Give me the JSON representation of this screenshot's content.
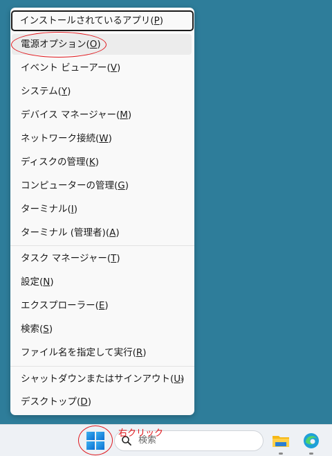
{
  "menu": {
    "items": [
      {
        "label": "インストールされているアプリ(",
        "key": "P",
        "suffix": ")"
      },
      {
        "label": "電源オプション(",
        "key": "O",
        "suffix": ")"
      },
      {
        "label": "イベント ビューアー(",
        "key": "V",
        "suffix": ")"
      },
      {
        "label": "システム(",
        "key": "Y",
        "suffix": ")"
      },
      {
        "label": "デバイス マネージャー(",
        "key": "M",
        "suffix": ")"
      },
      {
        "label": "ネットワーク接続(",
        "key": "W",
        "suffix": ")"
      },
      {
        "label": "ディスクの管理(",
        "key": "K",
        "suffix": ")"
      },
      {
        "label": "コンピューターの管理(",
        "key": "G",
        "suffix": ")"
      },
      {
        "label": "ターミナル(",
        "key": "I",
        "suffix": ")"
      },
      {
        "label": "ターミナル (管理者)(",
        "key": "A",
        "suffix": ")"
      },
      {
        "label": "タスク マネージャー(",
        "key": "T",
        "suffix": ")"
      },
      {
        "label": "設定(",
        "key": "N",
        "suffix": ")"
      },
      {
        "label": "エクスプローラー(",
        "key": "E",
        "suffix": ")"
      },
      {
        "label": "検索(",
        "key": "S",
        "suffix": ")"
      },
      {
        "label": "ファイル名を指定して実行(",
        "key": "R",
        "suffix": ")"
      },
      {
        "label": "シャットダウンまたはサインアウト(",
        "key": "U",
        "suffix": ")",
        "submenu_arrow": "›"
      },
      {
        "label": "デスクトップ(",
        "key": "D",
        "suffix": ")"
      }
    ]
  },
  "taskbar": {
    "search_placeholder": "検索",
    "icons": [
      "windows-start-icon",
      "search-icon",
      "file-explorer-icon",
      "edge-icon"
    ]
  },
  "annotation": {
    "right_click_text": "右クリック"
  },
  "colors": {
    "desktop": "#2e7d9a",
    "annotation_red": "#e0161b",
    "menu_bg": "#f9f9f9"
  }
}
